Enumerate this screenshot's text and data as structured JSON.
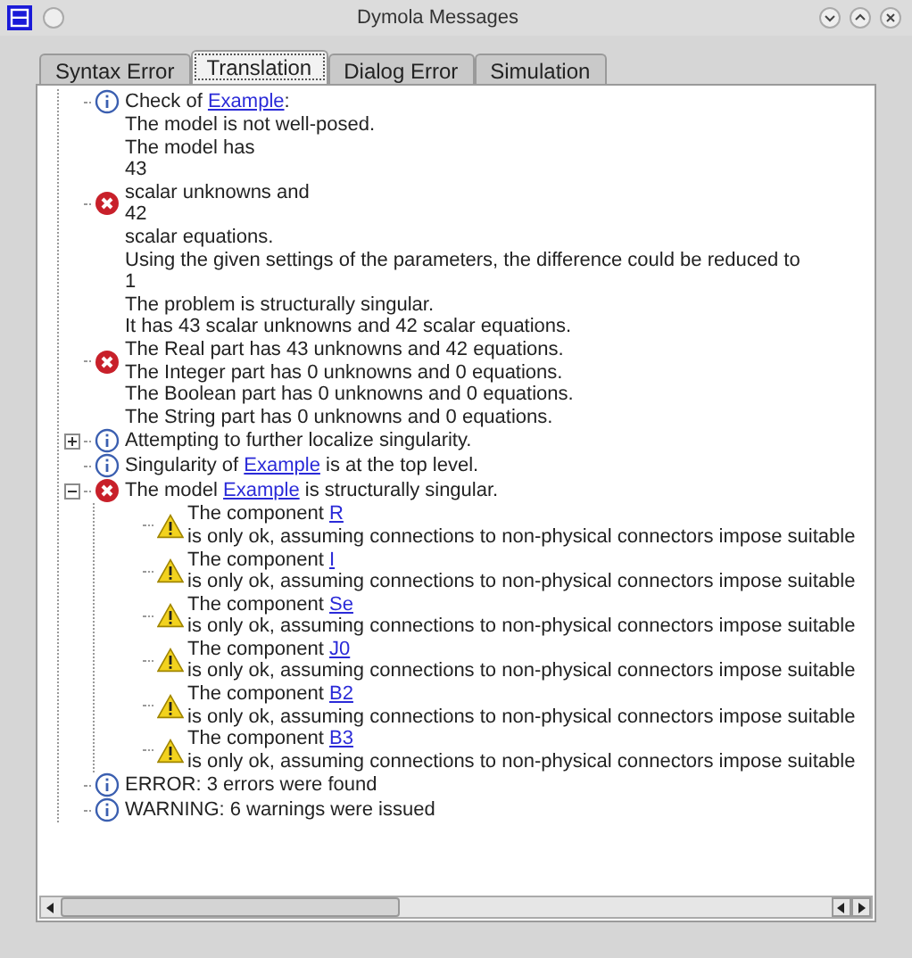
{
  "window": {
    "title": "Dymola Messages"
  },
  "tabs": [
    {
      "label": "Syntax Error",
      "selected": false
    },
    {
      "label": "Translation",
      "selected": true
    },
    {
      "label": "Dialog Error",
      "selected": false
    },
    {
      "label": "Simulation",
      "selected": false
    }
  ],
  "messages": [
    {
      "kind": "info",
      "lines": [
        [
          {
            "text": "Check of "
          },
          {
            "text": "Example",
            "link": true
          },
          {
            "text": ":"
          }
        ]
      ]
    },
    {
      "kind": "error",
      "lines": [
        [
          {
            "text": "The model is not well-posed."
          }
        ],
        [
          {
            "text": "The model has"
          }
        ],
        [
          {
            "text": "43"
          }
        ],
        [
          {
            "text": "scalar unknowns and"
          }
        ],
        [
          {
            "text": "42"
          }
        ],
        [
          {
            "text": "scalar equations."
          }
        ],
        [
          {
            "text": "Using the given settings of the parameters, the difference could be reduced to"
          }
        ],
        [
          {
            "text": "1"
          }
        ]
      ]
    },
    {
      "kind": "error",
      "lines": [
        [
          {
            "text": "The problem is structurally singular."
          }
        ],
        [
          {
            "text": "It has 43 scalar unknowns and 42 scalar equations."
          }
        ],
        [
          {
            "text": "The Real part has 43 unknowns and 42 equations."
          }
        ],
        [
          {
            "text": "The Integer part has 0 unknowns and 0 equations."
          }
        ],
        [
          {
            "text": "The Boolean part has 0 unknowns and 0 equations."
          }
        ],
        [
          {
            "text": "The String part has 0 unknowns and 0 equations."
          }
        ]
      ]
    },
    {
      "kind": "info",
      "expanded": false,
      "lines": [
        [
          {
            "text": "Attempting to further localize singularity."
          }
        ]
      ]
    },
    {
      "kind": "info",
      "lines": [
        [
          {
            "text": "Singularity of "
          },
          {
            "text": "Example",
            "link": true
          },
          {
            "text": " is at the top level."
          }
        ]
      ]
    },
    {
      "kind": "error",
      "expanded": true,
      "lines": [
        [
          {
            "text": "The model "
          },
          {
            "text": "Example",
            "link": true
          },
          {
            "text": " is structurally singular."
          }
        ]
      ],
      "children": [
        {
          "kind": "warning",
          "lines": [
            [
              {
                "text": "The component "
              },
              {
                "text": "R",
                "link": true
              }
            ],
            [
              {
                "text": "is only ok, assuming connections to non-physical connectors impose suitable"
              }
            ]
          ]
        },
        {
          "kind": "warning",
          "lines": [
            [
              {
                "text": "The component "
              },
              {
                "text": "I",
                "link": true
              }
            ],
            [
              {
                "text": "is only ok, assuming connections to non-physical connectors impose suitable"
              }
            ]
          ]
        },
        {
          "kind": "warning",
          "lines": [
            [
              {
                "text": "The component "
              },
              {
                "text": "Se",
                "link": true
              }
            ],
            [
              {
                "text": "is only ok, assuming connections to non-physical connectors impose suitable"
              }
            ]
          ]
        },
        {
          "kind": "warning",
          "lines": [
            [
              {
                "text": "The component "
              },
              {
                "text": "J0",
                "link": true
              }
            ],
            [
              {
                "text": "is only ok, assuming connections to non-physical connectors impose suitable"
              }
            ]
          ]
        },
        {
          "kind": "warning",
          "lines": [
            [
              {
                "text": "The component "
              },
              {
                "text": "B2",
                "link": true
              }
            ],
            [
              {
                "text": "is only ok, assuming connections to non-physical connectors impose suitable"
              }
            ]
          ]
        },
        {
          "kind": "warning",
          "lines": [
            [
              {
                "text": "The component "
              },
              {
                "text": "B3",
                "link": true
              }
            ],
            [
              {
                "text": "is only ok, assuming connections to non-physical connectors impose suitable"
              }
            ]
          ]
        }
      ]
    },
    {
      "kind": "info",
      "lines": [
        [
          {
            "text": "ERROR: 3 errors were found"
          }
        ]
      ]
    },
    {
      "kind": "info",
      "lines": [
        [
          {
            "text": "WARNING: 6 warnings were issued"
          }
        ]
      ]
    }
  ]
}
